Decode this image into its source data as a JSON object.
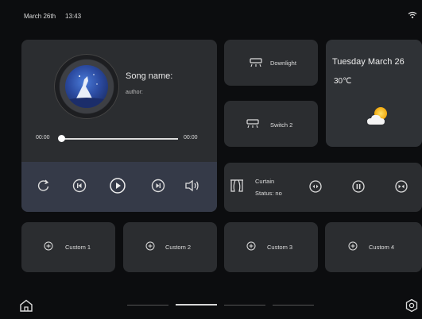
{
  "status": {
    "date": "March 26th",
    "time": "13:43"
  },
  "music": {
    "song_name": "Song name:",
    "author": "author:",
    "time_start": "00:00",
    "time_end": "00:00",
    "progress": 0
  },
  "tiles": {
    "downlight": "Downlight",
    "switch2": "Switch 2"
  },
  "weather": {
    "date": "Tuesday March 26",
    "temp": "30℃"
  },
  "curtain": {
    "title": "Curtain",
    "status": "Status: no"
  },
  "custom": {
    "c1": "Custom 1",
    "c2": "Custom 2",
    "c3": "Custom 3",
    "c4": "Custom 4"
  },
  "pager": {
    "count": 4,
    "active": 1
  }
}
